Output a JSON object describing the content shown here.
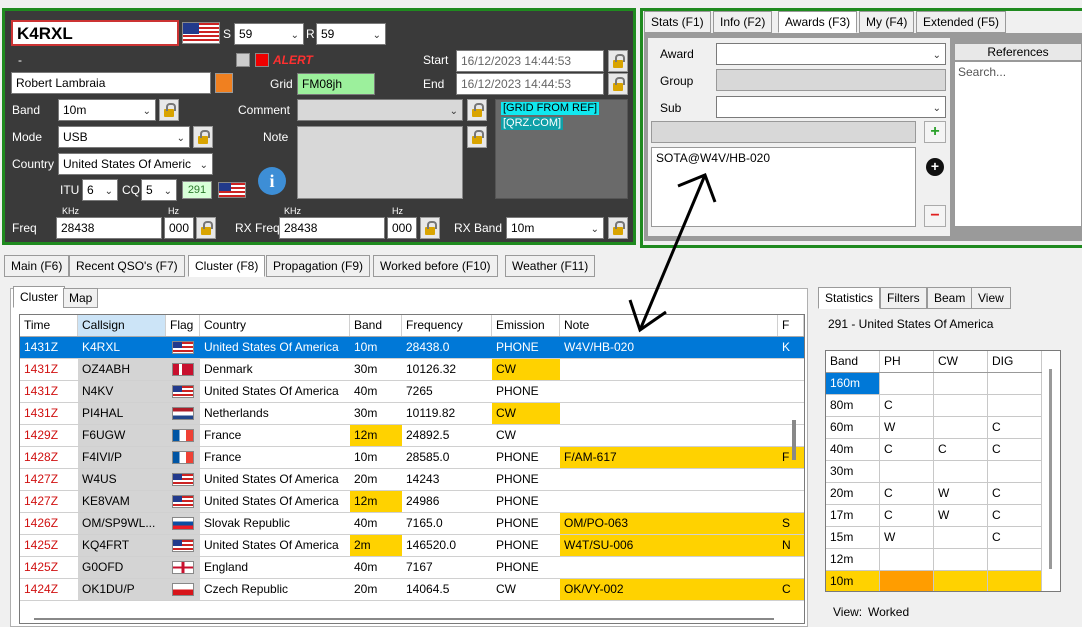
{
  "qso": {
    "callsign": "K4RXL",
    "s_label": "S",
    "s_value": "59",
    "r_label": "R",
    "r_value": "59",
    "dash": "-",
    "alert": "ALERT",
    "name": "Robert Lambraia",
    "grid_label": "Grid",
    "grid": "FM08jh",
    "start_label": "Start",
    "start": "16/12/2023 14:44:53",
    "end_label": "End",
    "end": "16/12/2023 14:44:53",
    "band_label": "Band",
    "band": "10m",
    "mode_label": "Mode",
    "mode": "USB",
    "country_label": "Country",
    "country": "United States Of Americ",
    "itu_label": "ITU",
    "itu": "6",
    "cq_label": "CQ",
    "cq": "5",
    "dxcc": "291",
    "comment_label": "Comment",
    "note_label": "Note",
    "khz": "KHz",
    "hz": "Hz",
    "freq_label": "Freq",
    "freq": "28438",
    "freq_hz": "000",
    "rxfreq_label": "RX Freq",
    "rxfreq": "28438",
    "rxfreq_hz": "000",
    "rxband_label": "RX Band",
    "rxband": "10m",
    "tags": [
      "[GRID FROM REF]",
      "[QRZ.COM]"
    ]
  },
  "awards": {
    "tabs": [
      "Stats (F1)",
      "Info (F2)",
      "Awards (F3)",
      "My (F4)",
      "Extended (F5)"
    ],
    "award_label": "Award",
    "group_label": "Group",
    "sub_label": "Sub",
    "references_label": "References",
    "search_placeholder": "Search...",
    "reference": "SOTA@W4V/HB-020"
  },
  "main_tabs": [
    "Main (F6)",
    "Recent QSO's (F7)",
    "Cluster (F8)",
    "Propagation (F9)",
    "Worked before (F10)",
    "Weather (F11)"
  ],
  "sub_tabs": [
    "Cluster",
    "Map"
  ],
  "cluster": {
    "columns": [
      "Time",
      "Callsign",
      "Flag",
      "Country",
      "Band",
      "Frequency",
      "Emission",
      "Note",
      "F"
    ],
    "rows": [
      {
        "time": "1431Z",
        "call": "K4RXL",
        "flag": "us",
        "country": "United States Of America",
        "band": "10m",
        "freq": "28438.0",
        "em": "PHONE",
        "note": "W4V/HB-020",
        "f": "K",
        "sel": true
      },
      {
        "time": "1431Z",
        "call": "OZ4ABH",
        "flag": "dk",
        "country": "Denmark",
        "band": "30m",
        "freq": "10126.32",
        "em": "CW",
        "note": "",
        "f": "",
        "emhl": true
      },
      {
        "time": "1431Z",
        "call": "N4KV",
        "flag": "us",
        "country": "United States Of America",
        "band": "40m",
        "freq": "7265",
        "em": "PHONE",
        "note": "",
        "f": ""
      },
      {
        "time": "1431Z",
        "call": "PI4HAL",
        "flag": "nl",
        "country": "Netherlands",
        "band": "30m",
        "freq": "10119.82",
        "em": "CW",
        "note": "",
        "f": "",
        "emhl": true
      },
      {
        "time": "1429Z",
        "call": "F6UGW",
        "flag": "fr",
        "country": "France",
        "band": "12m",
        "freq": "24892.5",
        "em": "CW",
        "note": "",
        "f": "",
        "bandhl": true
      },
      {
        "time": "1428Z",
        "call": "F4IVI/P",
        "flag": "fr",
        "country": "France",
        "band": "10m",
        "freq": "28585.0",
        "em": "PHONE",
        "note": "F/AM-617",
        "f": "F",
        "notehl": true
      },
      {
        "time": "1427Z",
        "call": "W4US",
        "flag": "us",
        "country": "United States Of America",
        "band": "20m",
        "freq": "14243",
        "em": "PHONE",
        "note": "",
        "f": ""
      },
      {
        "time": "1427Z",
        "call": "KE8VAM",
        "flag": "us",
        "country": "United States Of America",
        "band": "12m",
        "freq": "24986",
        "em": "PHONE",
        "note": "",
        "f": "",
        "bandhl": true
      },
      {
        "time": "1426Z",
        "call": "OM/SP9WL...",
        "flag": "sk",
        "country": "Slovak Republic",
        "band": "40m",
        "freq": "7165.0",
        "em": "PHONE",
        "note": "OM/PO-063",
        "f": "S",
        "notehl": true
      },
      {
        "time": "1425Z",
        "call": "KQ4FRT",
        "flag": "us",
        "country": "United States Of America",
        "band": "2m",
        "freq": "146520.0",
        "em": "PHONE",
        "note": "W4T/SU-006",
        "f": "N",
        "bandhl": true,
        "notehl": true
      },
      {
        "time": "1425Z",
        "call": "G0OFD",
        "flag": "en",
        "country": "England",
        "band": "40m",
        "freq": "7167",
        "em": "PHONE",
        "note": "",
        "f": ""
      },
      {
        "time": "1424Z",
        "call": "OK1DU/P",
        "flag": "cz",
        "country": "Czech Republic",
        "band": "20m",
        "freq": "14064.5",
        "em": "CW",
        "note": "OK/VY-002",
        "f": "C",
        "notehl": true
      }
    ]
  },
  "side_tabs": [
    "Statistics",
    "Filters",
    "Beam",
    "View"
  ],
  "stats": {
    "title": "291 - United States Of America",
    "columns": [
      "Band",
      "PH",
      "CW",
      "DIG"
    ],
    "rows": [
      [
        "160m",
        "",
        "",
        ""
      ],
      [
        "80m",
        "C",
        "",
        ""
      ],
      [
        "60m",
        "W",
        "",
        "C"
      ],
      [
        "40m",
        "C",
        "C",
        "C"
      ],
      [
        "30m",
        "",
        "",
        ""
      ],
      [
        "20m",
        "C",
        "W",
        "C"
      ],
      [
        "17m",
        "C",
        "W",
        "C"
      ],
      [
        "15m",
        "W",
        "",
        "C"
      ],
      [
        "12m",
        "",
        "",
        ""
      ],
      [
        "10m",
        "",
        "",
        ""
      ]
    ],
    "view_label": "View:",
    "view_value": "Worked"
  },
  "colors": {
    "accent_green": "#1f8a1f",
    "highlight": "#ffd200",
    "selection": "#0078d7",
    "time_red": "#d01010"
  }
}
